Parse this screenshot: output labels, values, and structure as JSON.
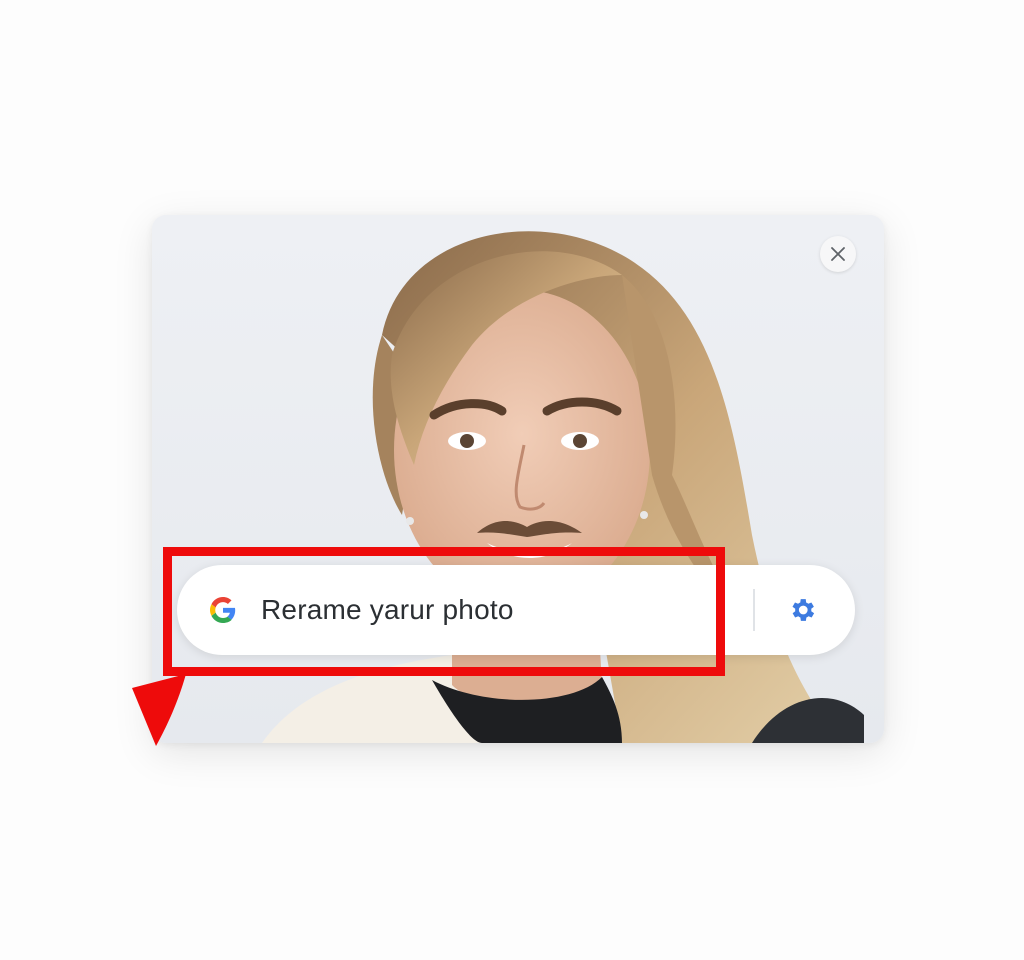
{
  "search": {
    "query": "Rerame yarur photo",
    "logo_icon": "google-g-icon",
    "settings_icon": "gear-icon"
  },
  "dialog": {
    "close_icon": "close-icon"
  },
  "annotation": {
    "highlight_color": "#ee0b0b",
    "arrow_color": "#ee0b0b"
  },
  "colors": {
    "google_blue": "#4285F4",
    "google_red": "#EA4335",
    "google_yellow": "#FBBC05",
    "google_green": "#34A853",
    "gear_blue": "#3d7be0"
  }
}
